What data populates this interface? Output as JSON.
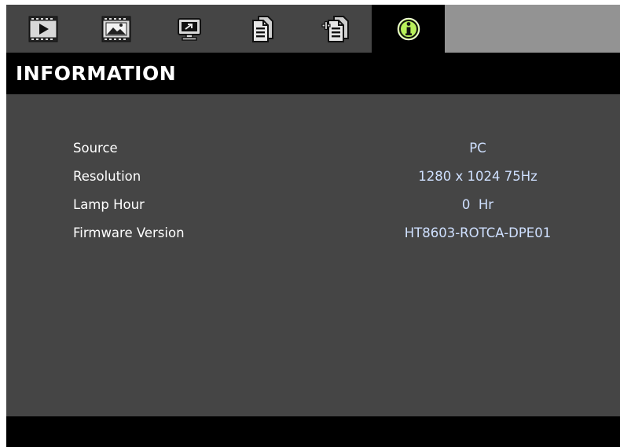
{
  "tabs": [
    {
      "icon": "play-screen-icon",
      "active": false
    },
    {
      "icon": "picture-icon",
      "active": false
    },
    {
      "icon": "display-icon",
      "active": false
    },
    {
      "icon": "settings-document-icon",
      "active": false
    },
    {
      "icon": "advanced-settings-document-icon",
      "active": false
    },
    {
      "icon": "information-icon",
      "active": true
    }
  ],
  "page": {
    "title": "INFORMATION"
  },
  "info": [
    {
      "label": "Source",
      "value": "PC"
    },
    {
      "label": "Resolution",
      "value": "1280 x 1024 75Hz"
    },
    {
      "label": "Lamp Hour",
      "value": "0  Hr"
    },
    {
      "label": "Firmware Version",
      "value": "HT8603-ROTCA-DPE01"
    }
  ],
  "colors": {
    "background": "#454545",
    "title_bar": "#000000",
    "value_text": "#cfe0ff",
    "active_icon": "#b8f05a",
    "tab_filler": "#939393"
  }
}
